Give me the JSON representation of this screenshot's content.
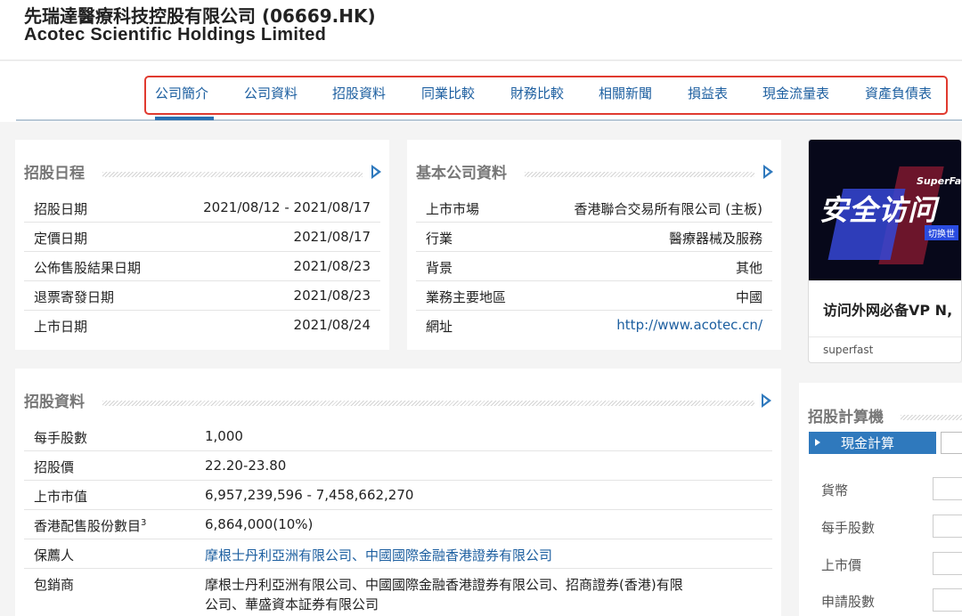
{
  "header": {
    "title_zh": "先瑞達醫療科技控股有限公司 (06669.HK)",
    "title_en": "Acotec Scientific Holdings Limited"
  },
  "nav": {
    "tabs": [
      {
        "label": "公司簡介",
        "active": true
      },
      {
        "label": "公司資料"
      },
      {
        "label": "招股資料"
      },
      {
        "label": "同業比較"
      },
      {
        "label": "財務比較"
      },
      {
        "label": "相關新聞"
      },
      {
        "label": "損益表"
      },
      {
        "label": "現金流量表"
      },
      {
        "label": "資產負債表"
      }
    ]
  },
  "ipo_schedule": {
    "title": "招股日程",
    "rows": [
      {
        "label": "招股日期",
        "value": "2021/08/12 - 2021/08/17"
      },
      {
        "label": "定價日期",
        "value": "2021/08/17"
      },
      {
        "label": "公佈售股結果日期",
        "value": "2021/08/23"
      },
      {
        "label": "退票寄發日期",
        "value": "2021/08/23"
      },
      {
        "label": "上市日期",
        "value": "2021/08/24"
      }
    ]
  },
  "company_info": {
    "title": "基本公司資料",
    "rows": [
      {
        "label": "上市市場",
        "value": "香港聯合交易所有限公司 (主板)"
      },
      {
        "label": "行業",
        "value": "醫療器械及服務"
      },
      {
        "label": "背景",
        "value": "其他"
      },
      {
        "label": "業務主要地區",
        "value": "中國"
      },
      {
        "label": "網址",
        "value": "http://www.acotec.cn/"
      }
    ]
  },
  "ipo_info": {
    "title": "招股資料",
    "rows": [
      {
        "label": "每手股數",
        "value": "1,000"
      },
      {
        "label": "招股價",
        "value": "22.20-23.80"
      },
      {
        "label": "上市市值",
        "value": "6,957,239,596 - 7,458,662,270"
      },
      {
        "label": "香港配售股份數目",
        "sup": "3",
        "value": "6,864,000(10%)"
      },
      {
        "label": "保薦人",
        "value": "摩根士丹利亞洲有限公司、中國國際金融香港證券有限公司"
      },
      {
        "label": "包銷商",
        "value_line1": "摩根士丹利亞洲有限公司、中國國際金融香港證券有限公司、招商證券(香港)有限",
        "value_line2": "公司、華盛資本証券有限公司"
      }
    ]
  },
  "ad": {
    "brand": "SuperFast",
    "slogan": "安全访问",
    "sub": "切换世",
    "text": "访问外网必备VP N,",
    "source": "superfast"
  },
  "calculator": {
    "title": "招股計算機",
    "tab_label": "現金計算",
    "fields": [
      "貨幣",
      "每手股數",
      "上市價",
      "申請股數"
    ]
  },
  "colors": {
    "accent": "#2f79bd",
    "link": "#1d5fa0",
    "highlight_box": "#e03a2f"
  }
}
